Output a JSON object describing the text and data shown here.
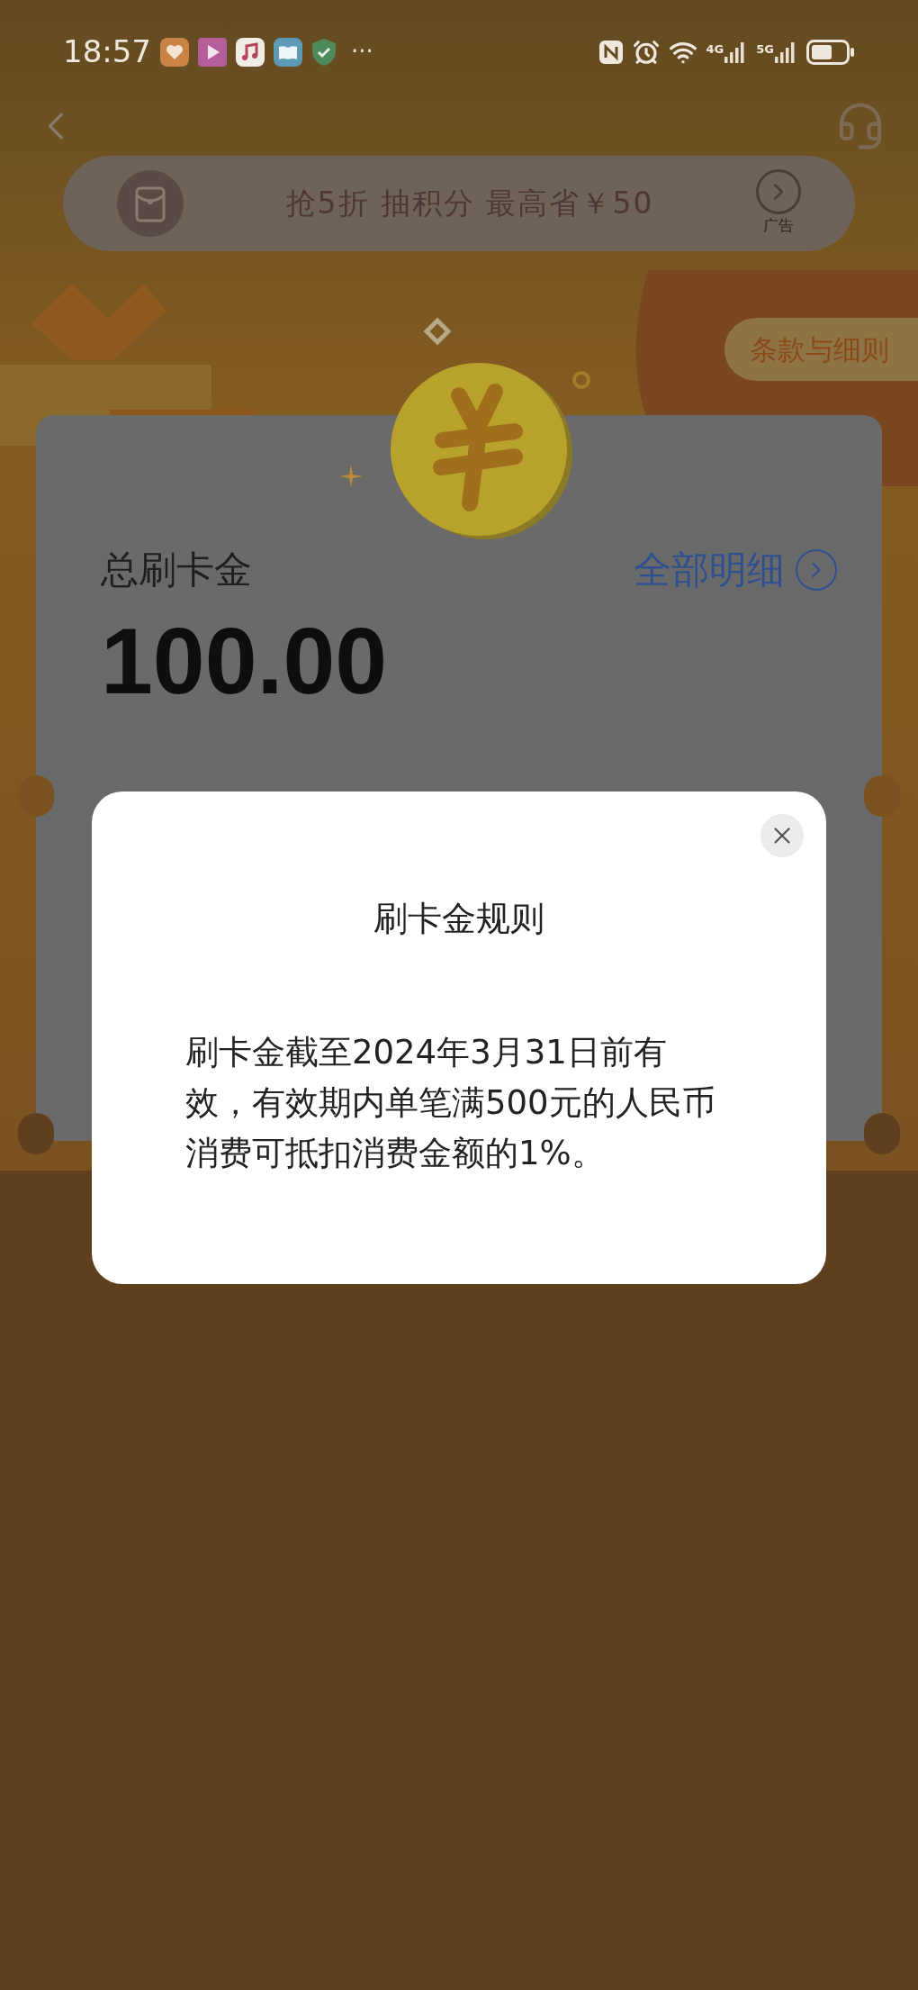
{
  "status_bar": {
    "time": "18:57",
    "more": "···",
    "network_labels": [
      "4G",
      "5G"
    ]
  },
  "banner": {
    "text": "抢5折 抽积分 最高省￥50",
    "ad_label": "广告"
  },
  "terms_button": "条款与细则",
  "card": {
    "label": "总刷卡金",
    "details_link": "全部明细",
    "amount": "100.00"
  },
  "dialog": {
    "title": "刷卡金规则",
    "body": "刷卡金截至2024年3月31日前有效，有效期内单笔满500元的人民币消费可抵扣消费金额的1%。"
  }
}
